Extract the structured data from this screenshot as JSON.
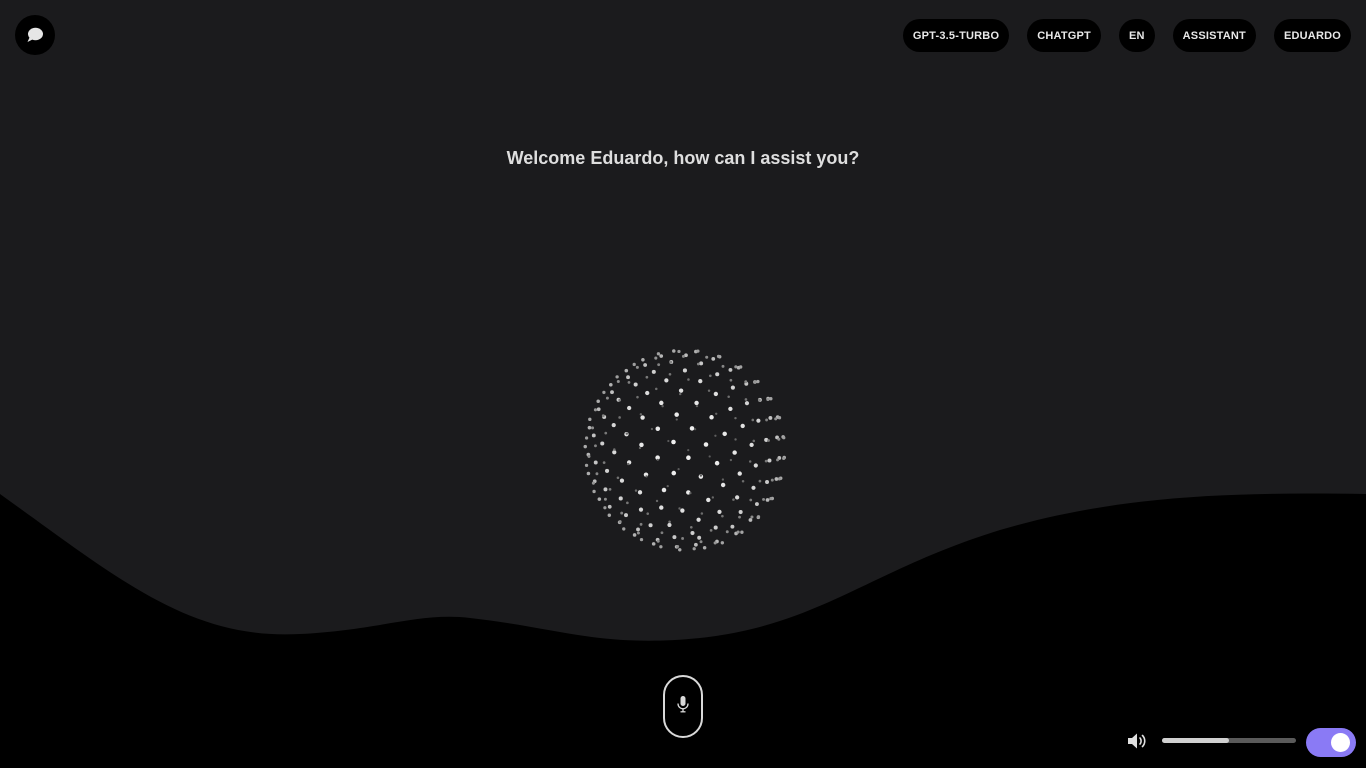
{
  "header": {
    "chat_icon": "chat-bubble-icon",
    "nav": [
      {
        "id": "model",
        "label": "GPT-3.5-TURBO"
      },
      {
        "id": "provider",
        "label": "CHATGPT"
      },
      {
        "id": "language",
        "label": "EN"
      },
      {
        "id": "role",
        "label": "ASSISTANT"
      },
      {
        "id": "user",
        "label": "EDUARDO"
      }
    ]
  },
  "main": {
    "welcome": "Welcome Eduardo, how can I assist you?"
  },
  "controls": {
    "mic_icon": "microphone-icon",
    "volume_icon": "speaker-icon",
    "volume_level": 0.5,
    "toggle_on": true
  },
  "colors": {
    "background": "#1b1b1d",
    "wave": "#000000",
    "accent": "#8a7af5"
  }
}
